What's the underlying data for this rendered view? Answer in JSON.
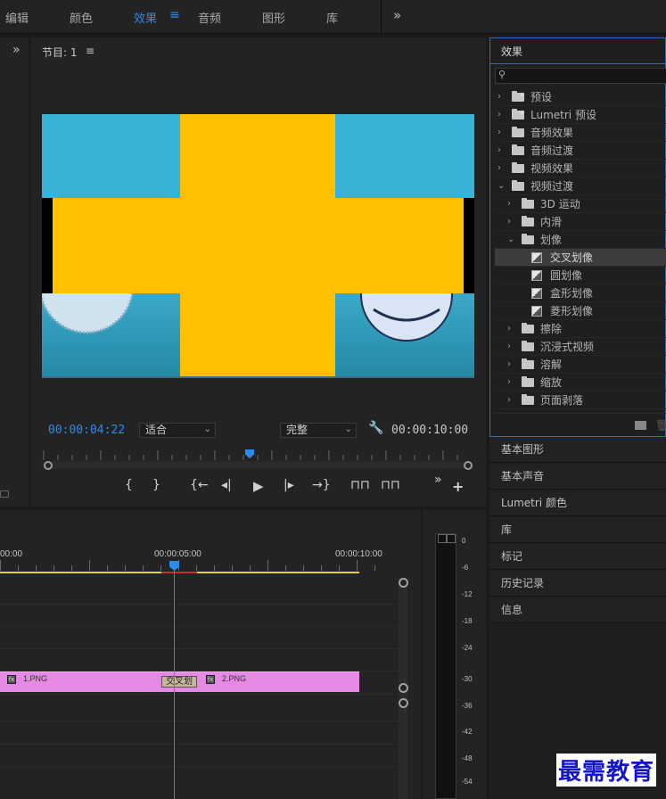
{
  "workspaces": {
    "tabs": [
      {
        "label": "编辑"
      },
      {
        "label": "颜色"
      },
      {
        "label": "效果"
      },
      {
        "label": "音频"
      },
      {
        "label": "图形"
      },
      {
        "label": "库"
      }
    ],
    "active_tab": "效果",
    "menu_glyph": "≡",
    "more_glyph": "»"
  },
  "program": {
    "title": "节目: 1",
    "menu_glyph": "≡",
    "current_timecode": "00:00:04:22",
    "fit_option": "适合",
    "quality_option": "完整",
    "duration_timecode": "00:00:10:00"
  },
  "effects_panel": {
    "title": "效果",
    "items": [
      {
        "label": "预设",
        "level": 0,
        "kind": "preset-folder",
        "expanded": false
      },
      {
        "label": "Lumetri 预设",
        "level": 0,
        "kind": "preset-folder",
        "expanded": false
      },
      {
        "label": "音频效果",
        "level": 0,
        "kind": "folder",
        "expanded": false
      },
      {
        "label": "音频过渡",
        "level": 0,
        "kind": "folder",
        "expanded": false
      },
      {
        "label": "视频效果",
        "level": 0,
        "kind": "folder",
        "expanded": false
      },
      {
        "label": "视频过渡",
        "level": 0,
        "kind": "folder",
        "expanded": true
      },
      {
        "label": "3D 运动",
        "level": 1,
        "kind": "folder",
        "expanded": false
      },
      {
        "label": "内滑",
        "level": 1,
        "kind": "folder",
        "expanded": false
      },
      {
        "label": "划像",
        "level": 1,
        "kind": "folder",
        "expanded": true
      },
      {
        "label": "交叉划像",
        "level": 2,
        "kind": "transition",
        "selected": true
      },
      {
        "label": "圆划像",
        "level": 2,
        "kind": "transition"
      },
      {
        "label": "盒形划像",
        "level": 2,
        "kind": "transition"
      },
      {
        "label": "菱形划像",
        "level": 2,
        "kind": "transition"
      },
      {
        "label": "擦除",
        "level": 1,
        "kind": "folder",
        "expanded": false
      },
      {
        "label": "沉浸式视频",
        "level": 1,
        "kind": "folder",
        "expanded": false
      },
      {
        "label": "溶解",
        "level": 1,
        "kind": "folder",
        "expanded": false
      },
      {
        "label": "缩放",
        "level": 1,
        "kind": "folder",
        "expanded": false
      },
      {
        "label": "页面剥落",
        "level": 1,
        "kind": "folder",
        "expanded": false
      }
    ]
  },
  "side_panels": [
    {
      "label": "基本图形"
    },
    {
      "label": "基本声音"
    },
    {
      "label": "Lumetri 颜色"
    },
    {
      "label": "库"
    },
    {
      "label": "标记"
    },
    {
      "label": "历史记录"
    },
    {
      "label": "信息"
    }
  ],
  "timeline": {
    "timecodes": [
      "00:00",
      "00:00:05:00",
      "00:00:10:00"
    ],
    "clips": [
      {
        "name": "1.PNG",
        "fx": "fx"
      },
      {
        "name": "2.PNG",
        "fx": "fx"
      }
    ],
    "transition_label": "交叉划"
  },
  "audio_meter": {
    "labels": [
      "0",
      "-6",
      "-12",
      "-18",
      "-24",
      "-30",
      "-36",
      "-42",
      "-48",
      "-54"
    ]
  },
  "watermark": "最需教育",
  "colors": {
    "accent_blue": "#2d8ceb",
    "clip_pink": "#e589e4",
    "video_gold": "#ffc000",
    "video_teal": "#39b2d8"
  }
}
